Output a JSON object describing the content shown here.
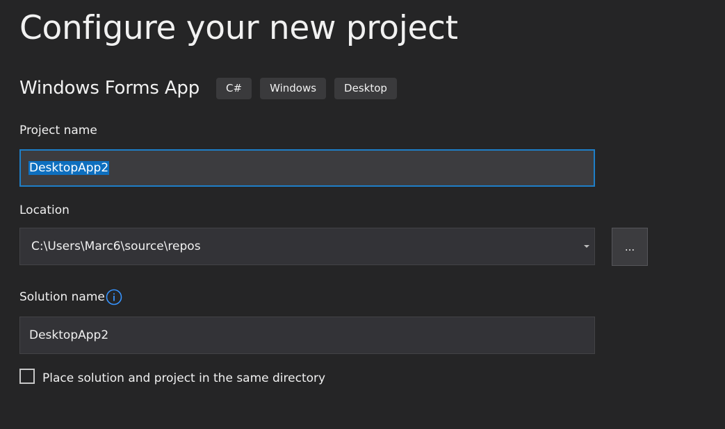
{
  "title": "Configure your new project",
  "template": {
    "name": "Windows Forms App",
    "tags": [
      "C#",
      "Windows",
      "Desktop"
    ]
  },
  "project_name": {
    "label": "Project name",
    "value": "DesktopApp2"
  },
  "location": {
    "label": "Location",
    "value": "C:\\Users\\Marc6\\source\\repos",
    "browse_label": "..."
  },
  "solution_name": {
    "label": "Solution name",
    "value": "DesktopApp2"
  },
  "same_directory": {
    "label": "Place solution and project in the same directory",
    "checked": false
  },
  "colors": {
    "background": "#252526",
    "focus_border": "#1e7fc8",
    "selection": "#0e6fbf",
    "info_icon": "#3794ff"
  },
  "icons": {
    "info": "info-icon",
    "dropdown": "chevron-down-icon"
  }
}
